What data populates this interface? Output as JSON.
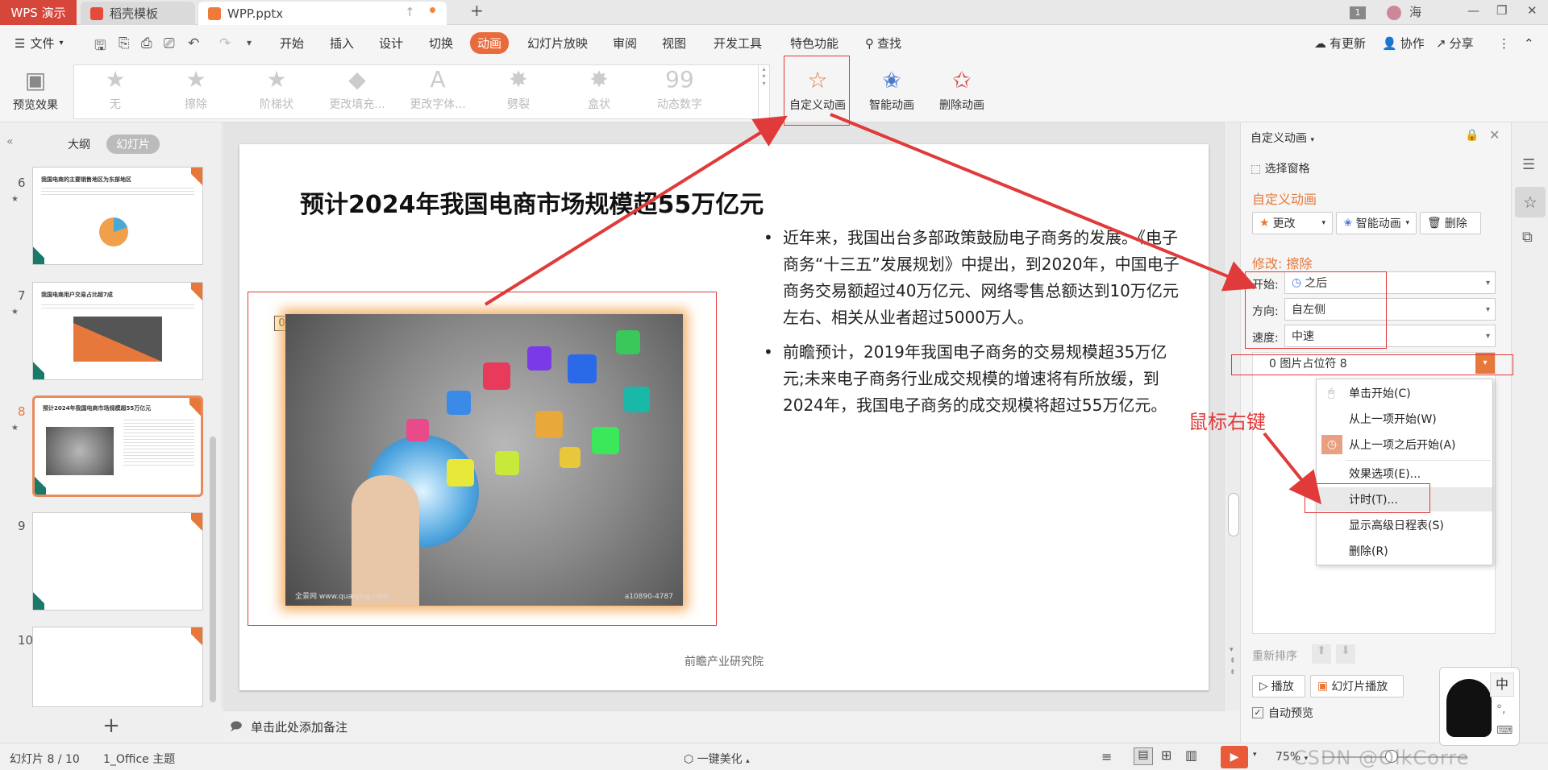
{
  "titlebar": {
    "app": "WPS 演示",
    "tabs": [
      {
        "label": "稻壳模板"
      },
      {
        "label": "WPP.pptx"
      }
    ],
    "badge": "1",
    "user": "海"
  },
  "menu": {
    "file": "文件",
    "items": [
      "开始",
      "插入",
      "设计",
      "切换",
      "动画",
      "幻灯片放映",
      "审阅",
      "视图",
      "开发工具",
      "特色功能"
    ],
    "active": "动画",
    "search": "查找",
    "right": [
      "有更新",
      "协作",
      "分享"
    ]
  },
  "ribbon": {
    "preview": "预览效果",
    "gallery": [
      {
        "label": "无",
        "glyph": "★"
      },
      {
        "label": "擦除",
        "glyph": "★"
      },
      {
        "label": "阶梯状",
        "glyph": "★"
      },
      {
        "label": "更改填充...",
        "glyph": "◆"
      },
      {
        "label": "更改字体...",
        "glyph": "A"
      },
      {
        "label": "劈裂",
        "glyph": "✸"
      },
      {
        "label": "盒状",
        "glyph": "✸"
      },
      {
        "label": "动态数字",
        "glyph": "99"
      }
    ],
    "custom": "自定义动画",
    "smart": "智能动画",
    "delete": "删除动画"
  },
  "left": {
    "outline": "大纲",
    "slides": "幻灯片",
    "thumbs": [
      {
        "num": "6",
        "title": "我国电商的主要销售地区为东部地区"
      },
      {
        "num": "7",
        "title": "我国电商用户交易占比超7成"
      },
      {
        "num": "8",
        "title": "预计2024年我国电商市场规模超55万亿元"
      },
      {
        "num": "9",
        "title": ""
      },
      {
        "num": "10",
        "title": ""
      }
    ]
  },
  "slide": {
    "title": "预计2024年我国电商市场规模超55万亿元",
    "bullet1": "近年来，我国出台多部政策鼓励电子商务的发展。《电子商务“十三五”发展规划》中提出，到2020年，中国电子商务交易额超过40万亿元、网络零售总额达到10万亿元左右、相关从业者超过5000万人。",
    "bullet2": "前瞻预计，2019年我国电子商务的交易规模超35万亿元;未来电子商务行业成交规模的增速将有所放缓，到2024年，我国电子商务的成交规模将超过55万亿元。",
    "footer": "前瞻产业研究院",
    "tag": "0",
    "img_wm_left": "全景网 www.quanjing.com",
    "img_wm_right": "a10890-4787"
  },
  "notes": "单击此处添加备注",
  "panel": {
    "header": "自定义动画",
    "select_pane": "选择窗格",
    "section": "自定义动画",
    "change": "更改",
    "smart": "智能动画",
    "delete": "删除",
    "modify": "修改: 擦除",
    "start_label": "开始:",
    "start_value": "之后",
    "dir_label": "方向:",
    "dir_value": "自左侧",
    "speed_label": "速度:",
    "speed_value": "中速",
    "list_item": "0   图片占位符 8",
    "reorder": "重新排序",
    "play": "播放",
    "slideshow": "幻灯片播放",
    "autopreview": "自动预览"
  },
  "context_menu": [
    "单击开始(C)",
    "从上一项开始(W)",
    "从上一项之后开始(A)",
    "效果选项(E)...",
    "计时(T)...",
    "显示高级日程表(S)",
    "删除(R)"
  ],
  "annotation": "鼠标右键",
  "status": {
    "slide": "幻灯片 8 / 10",
    "theme": "1_Office 主题",
    "beautify": "一键美化",
    "zoom": "75%",
    "watermark": "CSDN @OlkCorre"
  },
  "ime": "中"
}
